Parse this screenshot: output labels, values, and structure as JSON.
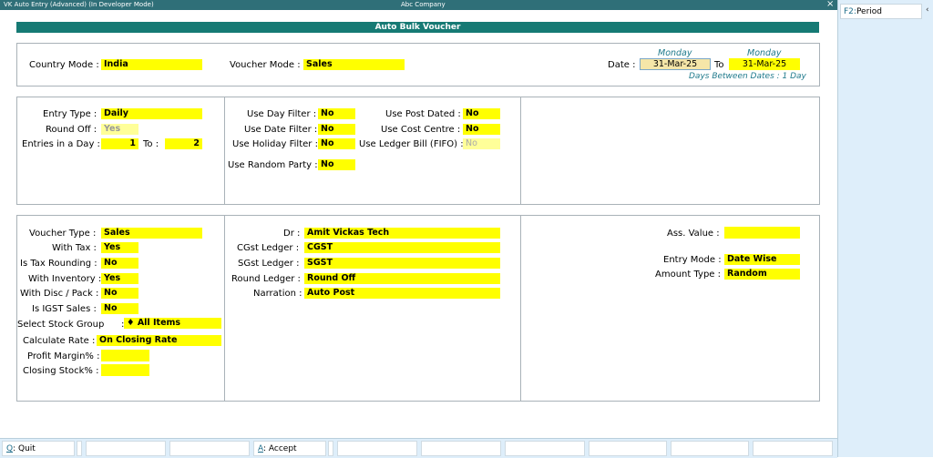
{
  "titlebar": {
    "app": "VK Auto Entry (Advanced) (In Developer Mode)",
    "company": "Abc Company",
    "close": "×"
  },
  "rightpanel": {
    "period_key": "F2:",
    "period_label": "Period",
    "arrow": "‹"
  },
  "banner": "Auto Bulk Voucher",
  "header": {
    "country_mode_label": "Country Mode :",
    "country_mode_value": "India",
    "voucher_mode_label": "Voucher Mode :",
    "voucher_mode_value": "Sales",
    "date_label": "Date :",
    "day_from": "Monday",
    "date_from": "31-Mar-25",
    "to_label": "To",
    "day_to": "Monday",
    "date_to": "31-Mar-25",
    "days_between": "Days Between Dates : 1 Day"
  },
  "section2": {
    "entry_type_label": "Entry Type :",
    "entry_type_value": "Daily",
    "round_off_label": "Round Off :",
    "round_off_value": "Yes",
    "entries_label": "Entries in a Day :",
    "entries_from": "1",
    "entries_to_label": "To :",
    "entries_to": "2",
    "use_day_filter_label": "Use Day Filter :",
    "use_day_filter_value": "No",
    "use_date_filter_label": "Use Date Filter :",
    "use_date_filter_value": "No",
    "use_holiday_filter_label": "Use Holiday Filter :",
    "use_holiday_filter_value": "No",
    "use_random_party_label": "Use Random Party :",
    "use_random_party_value": "No",
    "use_post_dated_label": "Use Post Dated :",
    "use_post_dated_value": "No",
    "use_cost_centre_label": "Use Cost Centre :",
    "use_cost_centre_value": "No",
    "use_ledger_bill_label": "Use Ledger Bill (FIFO) :",
    "use_ledger_bill_value": "No"
  },
  "section3": {
    "voucher_type_label": "Voucher Type :",
    "voucher_type_value": "Sales",
    "with_tax_label": "With Tax :",
    "with_tax_value": "Yes",
    "is_tax_rounding_label": "Is Tax Rounding :",
    "is_tax_rounding_value": "No",
    "with_inventory_label": "With Inventory :",
    "with_inventory_value": "Yes",
    "with_disc_label": "With Disc / Pack :",
    "with_disc_value": "No",
    "is_igst_label": "Is IGST Sales :",
    "is_igst_value": "No",
    "stock_group_label": "Select Stock Group",
    "stock_group_colon": ":",
    "stock_group_value": "♦ All Items",
    "calc_rate_label": "Calculate Rate :",
    "calc_rate_value": "On Closing Rate",
    "profit_margin_label": "Profit Margin% :",
    "profit_margin_value": "",
    "closing_stock_label": "Closing Stock% :",
    "closing_stock_value": "",
    "dr_label": "Dr :",
    "dr_value": "Amit Vickas Tech",
    "cgst_label": "CGst Ledger :",
    "cgst_value": "CGST",
    "sgst_label": "SGst Ledger :",
    "sgst_value": "SGST",
    "round_ledger_label": "Round Ledger :",
    "round_ledger_value": "Round Off",
    "narration_label": "Narration :",
    "narration_value": "Auto Post",
    "ass_value_label": "Ass. Value :",
    "ass_value_value": "",
    "entry_mode_label": "Entry Mode :",
    "entry_mode_value": "Date Wise",
    "amount_type_label": "Amount Type :",
    "amount_type_value": "Random"
  },
  "bottombar": {
    "quit_key": "Q",
    "quit_label": ": Quit",
    "accept_key": "A",
    "accept_label": ": Accept"
  }
}
